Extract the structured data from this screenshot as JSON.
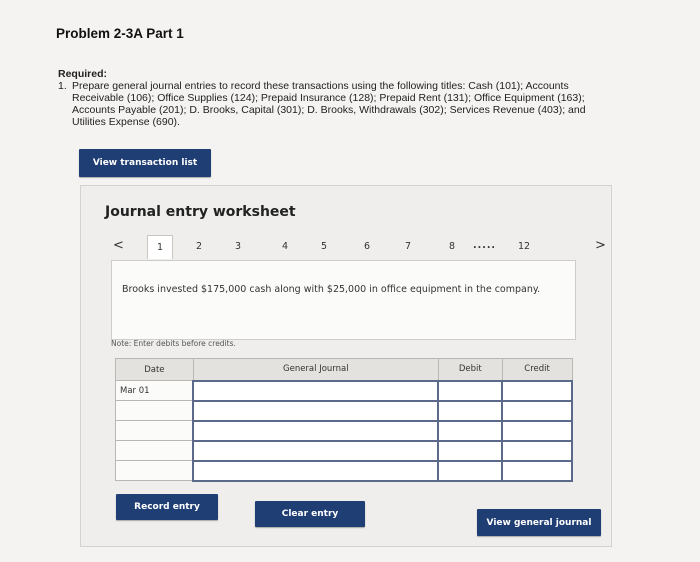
{
  "page": {
    "title": "Problem 2-3A Part 1"
  },
  "required": {
    "label": "Required:",
    "item_number": "1.",
    "item_text": "Prepare general journal entries to record these transactions using the following titles: Cash (101); Accounts Receivable (106); Office Supplies (124); Prepaid Insurance (128); Prepaid Rent (131); Office Equipment (163); Accounts Payable (201); D. Brooks, Capital (301); D. Brooks, Withdrawals (302); Services Revenue (403); and Utilities Expense (690)."
  },
  "buttons": {
    "view_transaction_list": "View transaction list",
    "record_entry": "Record entry",
    "clear_entry": "Clear entry",
    "view_general_journal": "View general journal"
  },
  "worksheet": {
    "title": "Journal entry worksheet",
    "pager": {
      "prev": "<",
      "next": ">",
      "pages": [
        "1",
        "2",
        "3",
        "4",
        "5",
        "6",
        "7",
        "8"
      ],
      "ellipsis": ".....",
      "last": "12",
      "active": "1"
    },
    "transaction_text": "Brooks invested $175,000 cash along with $25,000 in office equipment in the company.",
    "note": "Note: Enter debits before credits.",
    "table": {
      "headers": {
        "date": "Date",
        "general_journal": "General Journal",
        "debit": "Debit",
        "credit": "Credit"
      },
      "rows": [
        {
          "date": "Mar 01",
          "account": "",
          "debit": "",
          "credit": ""
        },
        {
          "date": "",
          "account": "",
          "debit": "",
          "credit": ""
        },
        {
          "date": "",
          "account": "",
          "debit": "",
          "credit": ""
        },
        {
          "date": "",
          "account": "",
          "debit": "",
          "credit": ""
        },
        {
          "date": "",
          "account": "",
          "debit": "",
          "credit": ""
        }
      ]
    }
  },
  "colors": {
    "button_bg": "#1f3e74",
    "input_border": "#5b6a8a"
  }
}
